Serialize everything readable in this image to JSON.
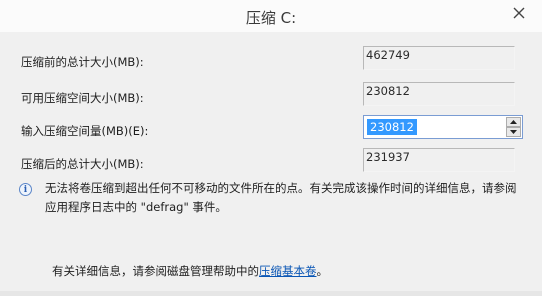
{
  "window": {
    "title": "压缩 C:"
  },
  "fields": {
    "total_before": {
      "label": "压缩前的总计大小(MB):",
      "value": "462749"
    },
    "available": {
      "label": "可用压缩空间大小(MB):",
      "value": "230812"
    },
    "amount": {
      "label": "输入压缩空间量(MB)(E):",
      "value": "230812"
    },
    "total_after": {
      "label": "压缩后的总计大小(MB):",
      "value": "231937"
    }
  },
  "info": {
    "icon": "info-icon",
    "text": "无法将卷压缩到超出任何不可移动的文件所在的点。有关完成该操作时间的详细信息，请参阅应用程序日志中的 \"defrag\" 事件。"
  },
  "help": {
    "prefix": "有关详细信息，请参阅磁盘管理帮助中的",
    "link": "压缩基本卷",
    "suffix": "。"
  }
}
